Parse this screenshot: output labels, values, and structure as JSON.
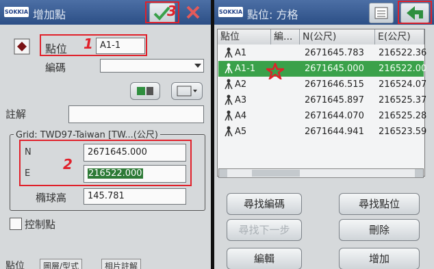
{
  "left": {
    "logo": "SOKKIA",
    "title": "增加點",
    "confirm_icon": "check-icon",
    "close_icon": "x-icon",
    "point_label": "點位",
    "point_value": "A1-1",
    "code_label": "編碼",
    "code_value": "",
    "note_label": "註解",
    "note_value": "",
    "grid_legend": "Grid: TWD97-Taiwan [TW...(公尺)",
    "n_label": "N",
    "n_value": "2671645.000",
    "e_label": "E",
    "e_value": "216522.000",
    "height_label": "橢球高",
    "height_value": "145.781",
    "control_label": "控制點",
    "tabs": [
      "點位",
      "圖層/型式",
      "相片註解"
    ],
    "annotations": [
      "1",
      "2",
      "3"
    ]
  },
  "right": {
    "logo": "SOKKIA",
    "title": "點位: 方格",
    "columns": [
      "點位",
      "編...",
      "N(公尺)",
      "E(公尺)"
    ],
    "rows": [
      {
        "point": "A1",
        "code": "",
        "n": "2671645.783",
        "e": "216522.36"
      },
      {
        "point": "A1-1",
        "code": "",
        "n": "2671645.000",
        "e": "216522.00"
      },
      {
        "point": "A2",
        "code": "",
        "n": "2671646.515",
        "e": "216524.07"
      },
      {
        "point": "A3",
        "code": "",
        "n": "2671645.897",
        "e": "216525.37"
      },
      {
        "point": "A4",
        "code": "",
        "n": "2671644.070",
        "e": "216525.28"
      },
      {
        "point": "A5",
        "code": "",
        "n": "2671644.941",
        "e": "216523.59"
      }
    ],
    "buttons": {
      "find_code": "尋找編碼",
      "find_point": "尋找點位",
      "find_next": "尋找下一步",
      "delete": "刪除",
      "edit": "編輯",
      "add": "增加"
    },
    "colors": {
      "selected_row": "#3aa14a",
      "highlight": "#e0202a"
    }
  }
}
